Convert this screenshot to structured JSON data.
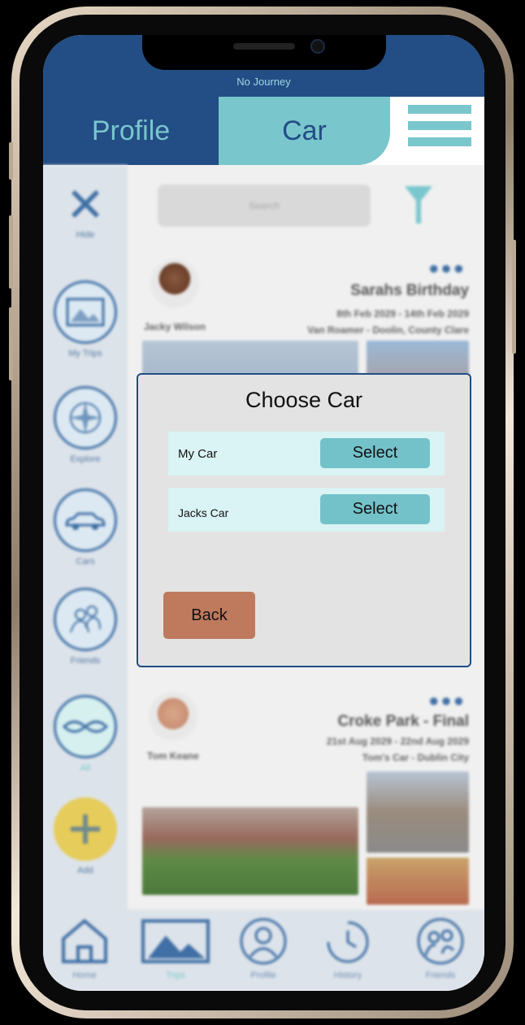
{
  "status": {
    "journey": "No Journey"
  },
  "tabs": {
    "profile": "Profile",
    "car": "Car"
  },
  "search": {
    "placeholder": "Search"
  },
  "sidebar": {
    "items": [
      {
        "label": "Hide"
      },
      {
        "label": "My Trips"
      },
      {
        "label": "Explore"
      },
      {
        "label": "Cars"
      },
      {
        "label": "Friends"
      },
      {
        "label": "All"
      },
      {
        "label": "Add"
      }
    ]
  },
  "trips": [
    {
      "user": "Jacky Wilson",
      "title": "Sarahs Birthday",
      "dates": "8th Feb 2029 - 14th Feb 2029",
      "details": "Van Roamer - Doolin, County Clare"
    },
    {
      "user": "Tom Keane",
      "title": "Croke Park - Final",
      "dates": "21st Aug 2029 - 22nd Aug 2029",
      "details": "Tom's Car - Dublin City"
    }
  ],
  "modal": {
    "title": "Choose Car",
    "cars": [
      {
        "name": "My Car",
        "action": "Select"
      },
      {
        "name": "Jacks Car",
        "action": "Select"
      }
    ],
    "back_label": "Back"
  },
  "bottom_nav": [
    {
      "label": "Home",
      "icon": "house-icon"
    },
    {
      "label": "Trips",
      "icon": "picture-icon"
    },
    {
      "label": "Profile",
      "icon": "person-icon"
    },
    {
      "label": "History",
      "icon": "clock-icon"
    },
    {
      "label": "Friends",
      "icon": "people-icon"
    }
  ],
  "colors": {
    "primary_blue": "#224d85",
    "teal": "#79c6cc",
    "back_button": "#bf7a5e",
    "row_bg": "#daf3f4"
  }
}
